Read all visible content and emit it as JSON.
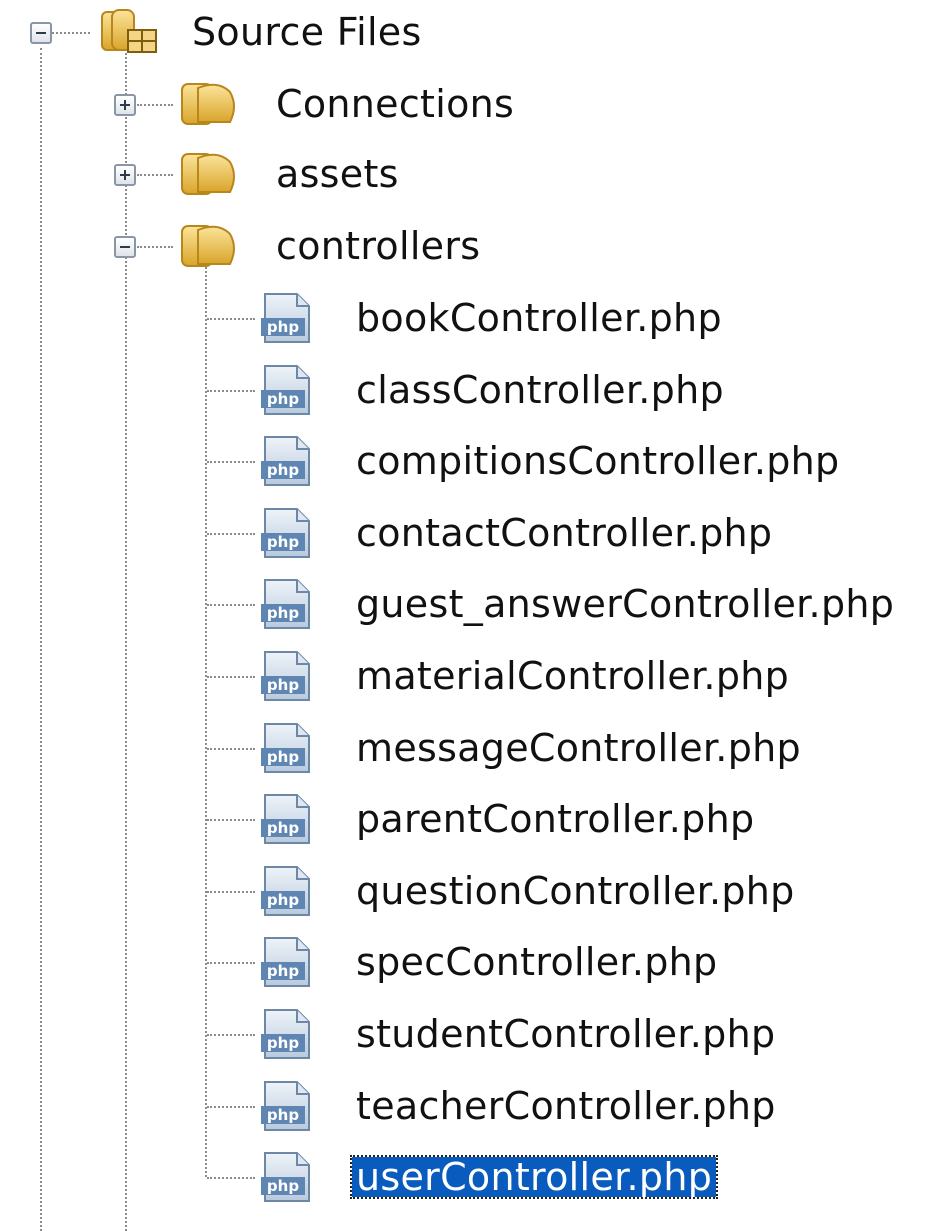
{
  "tree": {
    "root": {
      "label": "Source Files",
      "icon": "source-folder-icon",
      "expanded": true
    },
    "folders": [
      {
        "label": "Connections",
        "icon": "folder-icon",
        "expanded": false
      },
      {
        "label": "assets",
        "icon": "folder-icon",
        "expanded": false
      },
      {
        "label": "controllers",
        "icon": "folder-open-icon",
        "expanded": true
      }
    ],
    "files": [
      {
        "label": "bookController.php",
        "icon": "php-file-icon",
        "selected": false
      },
      {
        "label": "classController.php",
        "icon": "php-file-icon",
        "selected": false
      },
      {
        "label": "compitionsController.php",
        "icon": "php-file-icon",
        "selected": false
      },
      {
        "label": "contactController.php",
        "icon": "php-file-icon",
        "selected": false
      },
      {
        "label": "guest_answerController.php",
        "icon": "php-file-icon",
        "selected": false
      },
      {
        "label": "materialController.php",
        "icon": "php-file-icon",
        "selected": false
      },
      {
        "label": "messageController.php",
        "icon": "php-file-icon",
        "selected": false
      },
      {
        "label": "parentController.php",
        "icon": "php-file-icon",
        "selected": false
      },
      {
        "label": "questionController.php",
        "icon": "php-file-icon",
        "selected": false
      },
      {
        "label": "specController.php",
        "icon": "php-file-icon",
        "selected": false
      },
      {
        "label": "studentController.php",
        "icon": "php-file-icon",
        "selected": false
      },
      {
        "label": "teacherController.php",
        "icon": "php-file-icon",
        "selected": false
      },
      {
        "label": "userController.php",
        "icon": "php-file-icon",
        "selected": true
      }
    ],
    "php_icon_text": "php",
    "colors": {
      "selection_bg": "#0a5bbe",
      "selection_fg": "#ffffff",
      "folder": "#e9c04a",
      "php_icon": "#5f86b3"
    }
  }
}
